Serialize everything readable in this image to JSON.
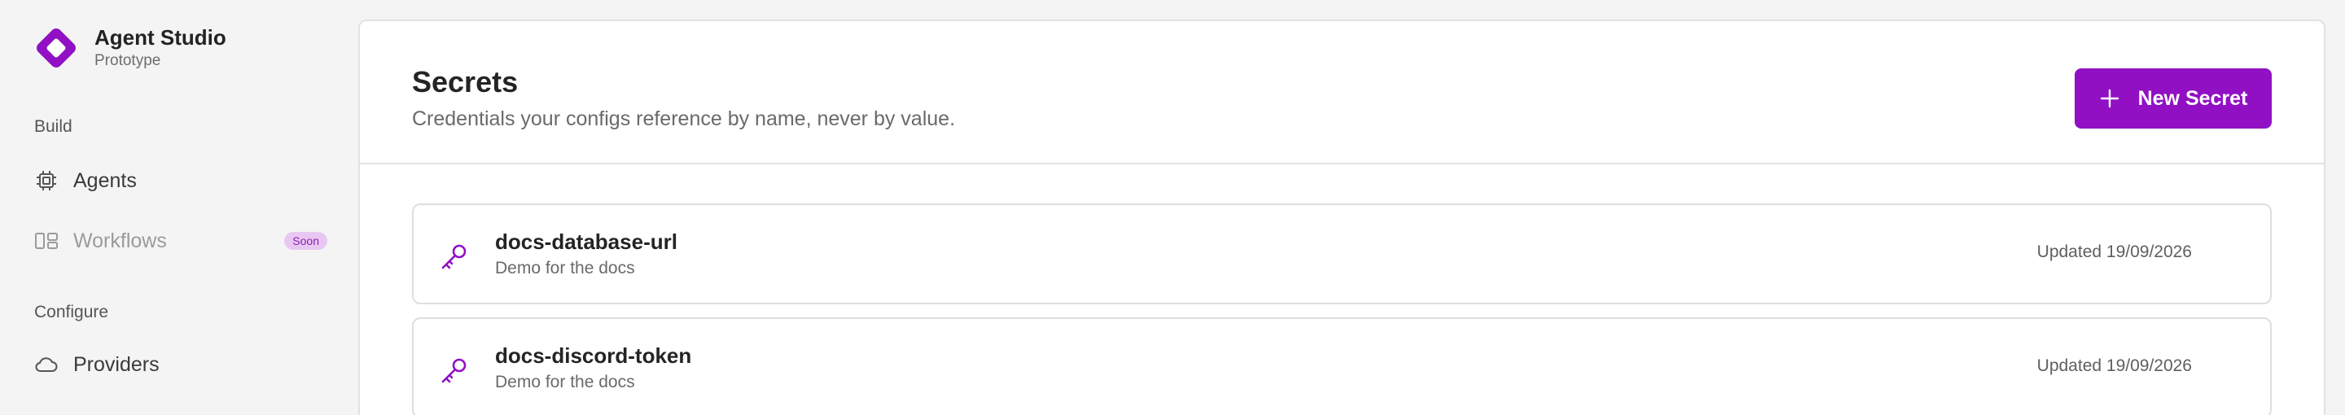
{
  "brand": {
    "name": "Agent Studio",
    "subtitle": "Prototype",
    "logo_icon": "diamond-logo-icon",
    "accent": "#9110c4"
  },
  "sidebar": {
    "sections": [
      {
        "label": "Build"
      },
      {
        "label": "Configure"
      }
    ],
    "items": [
      {
        "label": "Agents",
        "icon": "chip-icon"
      },
      {
        "label": "Workflows",
        "icon": "workflow-icon",
        "badge": "Soon",
        "disabled": true
      },
      {
        "label": "Providers",
        "icon": "cloud-icon"
      }
    ]
  },
  "main": {
    "title": "Secrets",
    "subtitle": "Credentials your configs reference by name, never by value.",
    "new_button_label": "New Secret",
    "secrets": [
      {
        "name": "docs-database-url",
        "description": "Demo for the docs",
        "updated": "Updated 19/09/2026"
      },
      {
        "name": "docs-discord-token",
        "description": "Demo for the docs",
        "updated": "Updated 19/09/2026"
      }
    ]
  }
}
